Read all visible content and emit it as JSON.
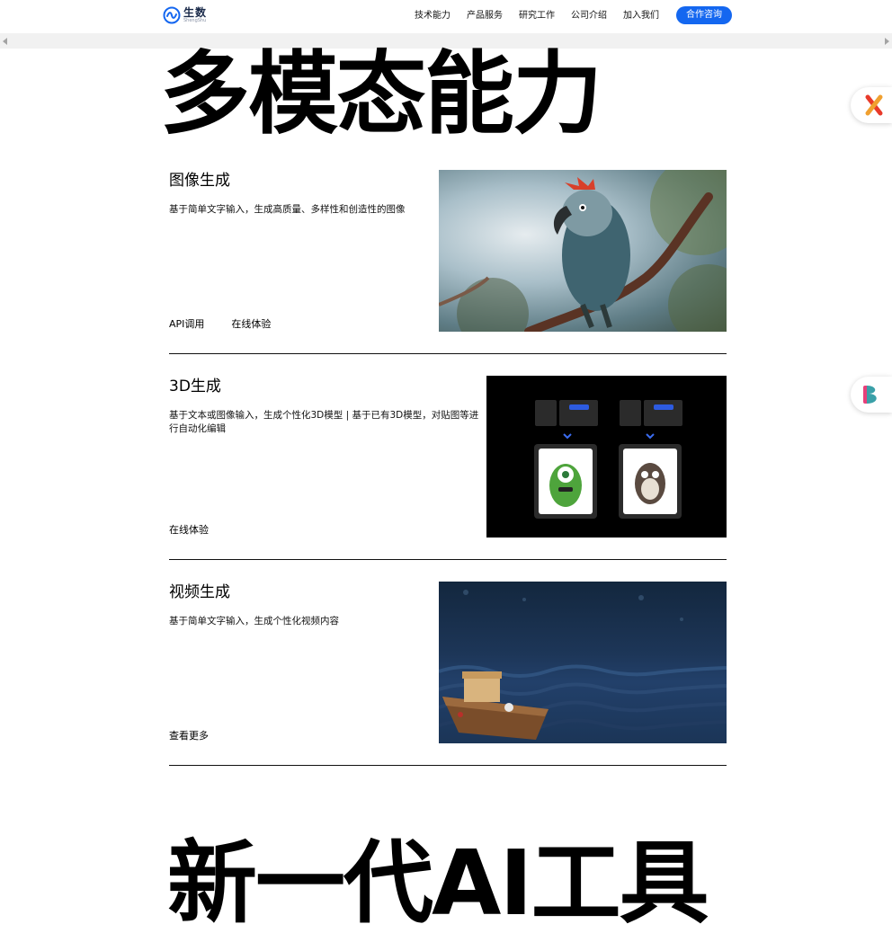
{
  "header": {
    "logo": {
      "cn": "生数",
      "en": "ShengShu"
    },
    "nav": [
      {
        "label": "技术能力"
      },
      {
        "label": "产品服务"
      },
      {
        "label": "研究工作"
      },
      {
        "label": "公司介绍"
      },
      {
        "label": "加入我们"
      }
    ],
    "cta_label": "合作咨询"
  },
  "headings": {
    "multimodal": "多模态能力",
    "next_gen": "新一代AI工具"
  },
  "sections": [
    {
      "title": "图像生成",
      "description": "基于简单文字输入，生成高质量、多样性和创造性的图像",
      "links": [
        "API调用",
        "在线体验"
      ],
      "image_icon": "parrot-image"
    },
    {
      "title": "3D生成",
      "description": "基于文本或图像输入，生成个性化3D模型 | 基于已有3D模型，对贴图等进行自动化编辑",
      "links": [
        "在线体验"
      ],
      "image_icon": "3d-models-image"
    },
    {
      "title": "视频生成",
      "description": "基于简单文字输入，生成个性化视频内容",
      "links": [
        "查看更多"
      ],
      "image_icon": "boat-video-image"
    }
  ],
  "colors": {
    "accent": "#1467f0",
    "text": "#000000",
    "divider": "#111111"
  }
}
